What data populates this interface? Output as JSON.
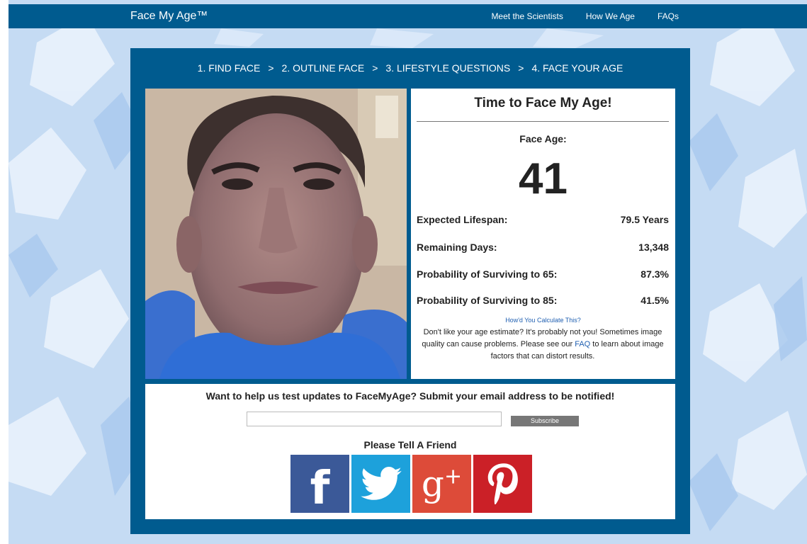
{
  "header": {
    "brand": "Face My Age™",
    "nav": [
      "Meet the Scientists",
      "How We Age",
      "FAQs"
    ]
  },
  "steps": [
    "1. FIND FACE",
    "2. OUTLINE FACE",
    "3. LIFESTYLE QUESTIONS",
    "4. FACE YOUR AGE"
  ],
  "steps_separator": ">",
  "results": {
    "title": "Time to Face My Age!",
    "face_age_label": "Face Age:",
    "face_age": "41",
    "stats": [
      {
        "label": "Expected Lifespan:",
        "value": "79.5 Years"
      },
      {
        "label": "Remaining Days:",
        "value": "13,348"
      },
      {
        "label": "Probability of Surviving to 65:",
        "value": "87.3%"
      },
      {
        "label": "Probability of Surviving to 85:",
        "value": "41.5%"
      }
    ],
    "calc_link": "How'd You Calculate This?",
    "note_before": "Don't like your age estimate? It's probably not you! Sometimes image quality can cause problems. Please see our ",
    "note_link": "FAQ",
    "note_after": " to learn about image factors that can distort results."
  },
  "subscribe": {
    "heading": "Want to help us test updates to FaceMyAge? Submit your email address to be notified!",
    "input_value": "",
    "button": "Subscribe"
  },
  "share": {
    "heading": "Please Tell A Friend",
    "networks": [
      {
        "name": "facebook",
        "glyph": "f",
        "color": "#3b5998"
      },
      {
        "name": "twitter",
        "color": "#1da1db"
      },
      {
        "name": "google-plus",
        "glyph": "g",
        "glyph_sup": "+",
        "color": "#dd4b39"
      },
      {
        "name": "pinterest",
        "color": "#cb2027"
      }
    ]
  },
  "colors": {
    "brand_blue": "#005b8f",
    "link_blue": "#1f5fb1",
    "background": "#c7dcf3"
  }
}
